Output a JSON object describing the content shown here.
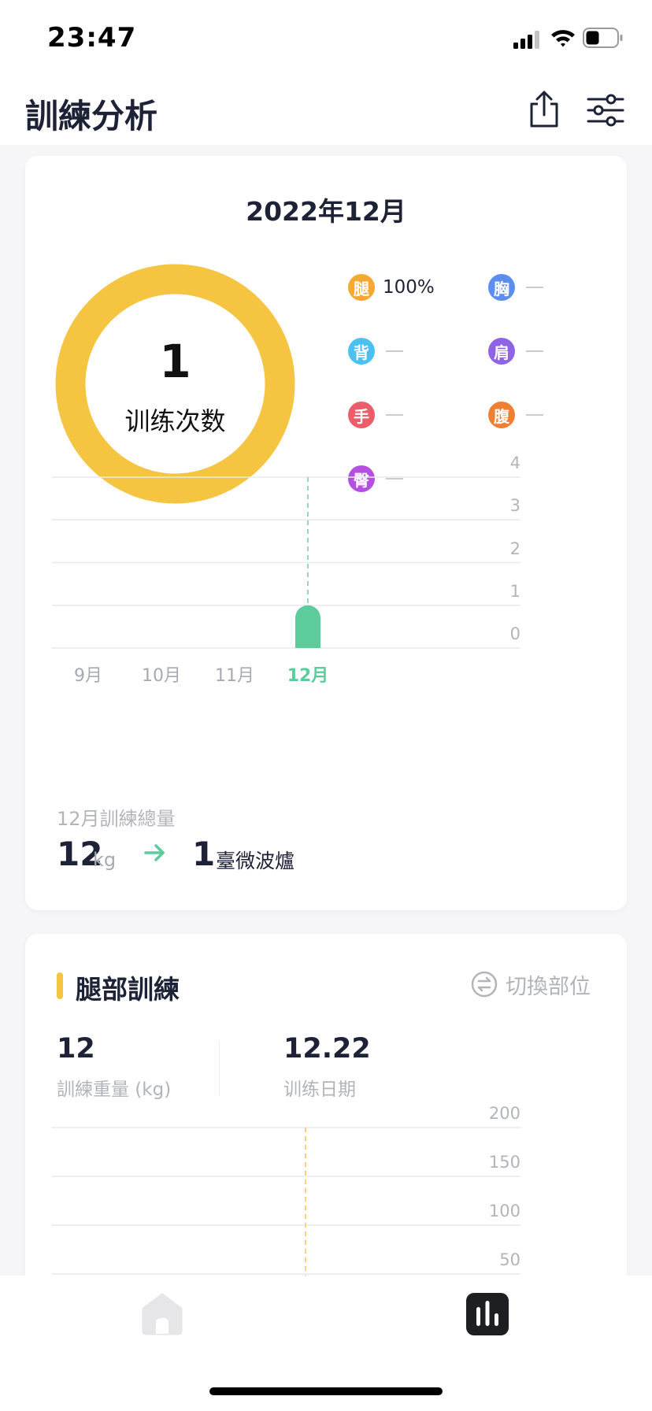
{
  "status_bar": {
    "time": "23:47"
  },
  "header": {
    "title": "訓練分析",
    "share_icon": "share-icon",
    "filter_icon": "sliders-icon"
  },
  "summary": {
    "month_title": "2022年12月",
    "donut": {
      "value": "1",
      "label": "训练次数",
      "fill_fraction": 1.0,
      "color": "#f5c542"
    },
    "legend": [
      {
        "badge": "腿",
        "value": "100%",
        "color": "#f5a933"
      },
      {
        "badge": "胸",
        "value": "",
        "color": "#5b8ef0"
      },
      {
        "badge": "背",
        "value": "",
        "color": "#4cc0f0"
      },
      {
        "badge": "肩",
        "value": "",
        "color": "#8e63e6"
      },
      {
        "badge": "手",
        "value": "",
        "color": "#ec5d6a"
      },
      {
        "badge": "腹",
        "value": "",
        "color": "#ef7f33"
      },
      {
        "badge": "臀",
        "value": "",
        "color": "#b44fe0"
      }
    ],
    "total_label": "12月訓練總量",
    "total_weight": "12",
    "total_weight_unit": "kg",
    "total_count": "1",
    "total_count_unit": "臺微波爐"
  },
  "leg_section": {
    "title": "腿部訓練",
    "switch_label": "切換部位",
    "weight_value": "12",
    "weight_label": "訓練重量 (kg)",
    "date_value": "12.22",
    "date_label": "训练日期"
  },
  "tab_bar": {
    "home_icon": "home-icon",
    "stats_icon": "bar-chart-icon"
  },
  "chart_data": [
    {
      "type": "bar",
      "categories": [
        "9月",
        "10月",
        "11月",
        "12月"
      ],
      "values": [
        0,
        0,
        0,
        1
      ],
      "yticks": [
        "0",
        "1",
        "2",
        "3",
        "4"
      ],
      "ylim": [
        0,
        4
      ],
      "grid": true,
      "highlight": "12月",
      "colors": {
        "bar": "#5ccc9c",
        "grid": "#e8e9ed",
        "marker": "#8fdcbd"
      }
    },
    {
      "type": "line",
      "yticks": [
        "50",
        "100",
        "150",
        "200"
      ],
      "ylim": [
        50,
        200
      ],
      "grid": true,
      "colors": {
        "grid": "#e8e9ed",
        "marker": "#f7d27a"
      }
    }
  ]
}
